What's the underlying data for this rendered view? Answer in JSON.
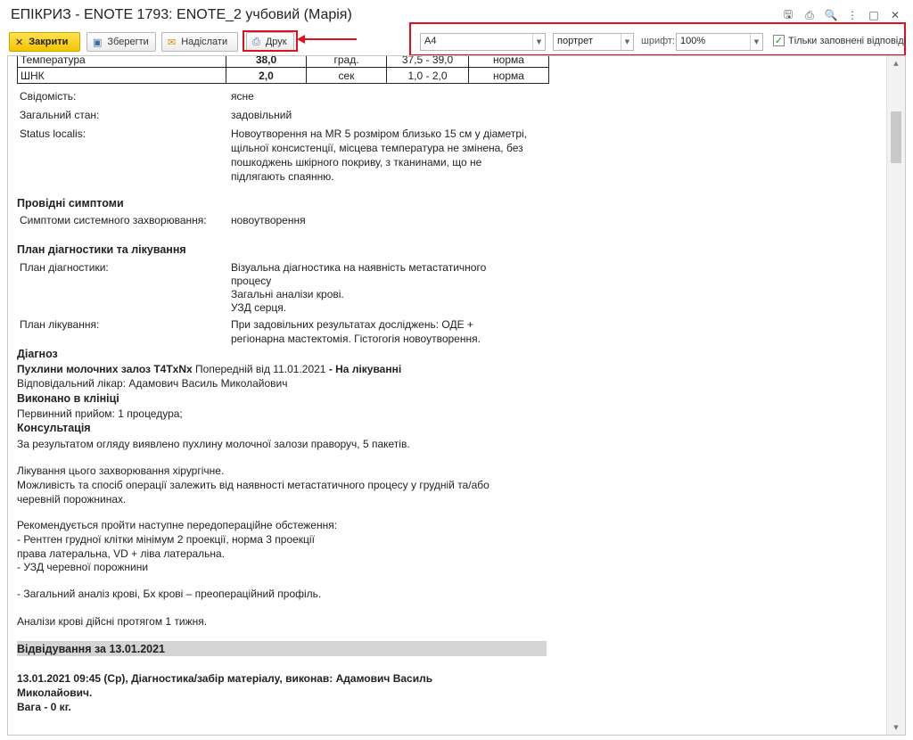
{
  "window": {
    "title": "ЕПІКРИЗ - ENOTE 1793: ENOTE_2 учбовий (Марія)",
    "icons": [
      "save-icon",
      "print-icon",
      "preview-icon",
      "more-icon",
      "maximize-icon",
      "close-icon"
    ]
  },
  "toolbar": {
    "close_label": "Закрити",
    "save_label": "Зберегти",
    "send_label": "Надіслати",
    "print_label": "Друк",
    "paper_size": "А4",
    "orientation": "портрет",
    "font_label": "шрифт:",
    "font_scale": "100%",
    "only_filled_label": "Тільки заповнені відповіді",
    "only_filled_checked": true
  },
  "vitals": [
    [
      "Температура",
      "38,0",
      "град.",
      "37,5 - 39,0",
      "норма"
    ],
    [
      "ШНК",
      "2,0",
      "сек",
      "1,0 - 2,0",
      "норма"
    ]
  ],
  "fields": {
    "consciousness_label": "Свідомість:",
    "consciousness_value": "ясне",
    "general_label": "Загальний стан:",
    "general_value": "задовільний",
    "status_label": "Status localis:",
    "status_lines": [
      "Новоутворення на MR 5 розміром близько 15 см у діаметрі,",
      "щільної консистенції, місцева температура не змінена, без",
      "пошкоджень шкірного покриву, з тканинами, що не",
      "підлягають спаянню."
    ]
  },
  "symptoms": {
    "heading": "Провідні симптоми",
    "label": "Симптоми системного захворювання:",
    "value": "новоутворення"
  },
  "plan": {
    "heading": "План діагностики та лікування",
    "diag_label": "План діагностики:",
    "diag_lines": [
      "Візуальна діагностика на наявність метастатичного",
      "процесу",
      "Загальні аналізи крові.",
      "УЗД серця."
    ],
    "treat_label": "План лікування:",
    "treat_lines": [
      "При задовільних результатах досліджень: ОДЕ +",
      "регіонарна мастектомія. Гістогогія новоутворення."
    ]
  },
  "diagnosis": {
    "heading": "Діагноз",
    "name": "Пухлини молочних залоз T4TxNx",
    "status": "Попередній від 11.01.2021",
    "state": "- На лікуванні",
    "doctor": "Відповідальний лікар: Адамович Василь Миколайович",
    "done_heading": "Виконано в клініці",
    "done_text": "Первинний прийом: 1 процедура;",
    "consult_heading": "Консультація",
    "consult_lines": [
      "За результатом огляду виявлено пухлину молочної залози праворуч, 5 пакетів.",
      "",
      "Лікування цього захворювання хірургічне.",
      "Можливість та спосіб операції залежить від наявності метастатичного процесу у грудній та/або",
      "черевній порожнинах.",
      "",
      "Рекомендується пройти наступне передопераційне обстеження:",
      "- Рентген грудної клітки мінімум 2 проекції, норма 3 проекції",
      "права латеральна, VD + ліва латеральна.",
      "- УЗД черевної порожнини",
      "",
      "- Загальний аналіз крові, Бх крові – преопераційний профіль.",
      "",
      "Аналізи крові дійсні протягом 1 тижня."
    ]
  },
  "visit": {
    "heading": "Відвідування за 13.01.2021",
    "line1": "13.01.2021 09:45 (Ср), Діагностика/забір матеріалу, виконав: Адамович Василь",
    "line2": "Миколайович.",
    "line3": "Вага - 0 кг."
  }
}
